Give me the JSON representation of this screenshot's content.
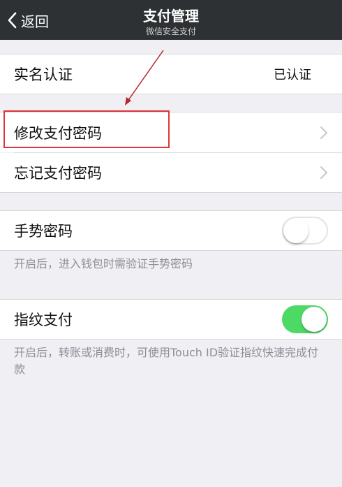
{
  "navbar": {
    "back_label": "返回",
    "title": "支付管理",
    "subtitle": "微信安全支付"
  },
  "sections": {
    "realname": {
      "label": "实名认证",
      "value": "已认证"
    },
    "password": {
      "change_label": "修改支付密码",
      "forgot_label": "忘记支付密码"
    },
    "gesture": {
      "label": "手势密码",
      "enabled": false,
      "footnote": "开启后，进入钱包时需验证手势密码"
    },
    "fingerprint": {
      "label": "指纹支付",
      "enabled": true,
      "footnote": "开启后，转账或消费时，可使用Touch ID验证指纹快速完成付款"
    }
  },
  "colors": {
    "navbar_bg": "#2e3134",
    "toggle_on": "#4cd964",
    "annotation_red": "#e0343a",
    "page_bg": "#efeff4"
  }
}
